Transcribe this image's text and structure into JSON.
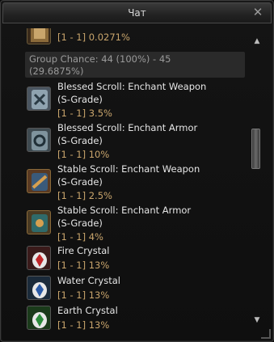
{
  "window": {
    "title": "Чат"
  },
  "top_partial_chance": "[1 - 1] 0.0271%",
  "group_chance": {
    "line1": "Group Chance: 44 (100%) - 45",
    "line2": "(29.6875%)"
  },
  "items": [
    {
      "name": "Blessed Scroll: Enchant Weapon",
      "grade": "(S-Grade)",
      "chance": "[1 - 1] 3.5%",
      "icon": "blessed-weapon-scroll-icon"
    },
    {
      "name": "Blessed Scroll: Enchant Armor",
      "grade": "(S-Grade)",
      "chance": "[1 - 1] 10%",
      "icon": "blessed-armor-scroll-icon"
    },
    {
      "name": "Stable Scroll: Enchant Weapon",
      "grade": "(S-Grade)",
      "chance": "[1 - 1] 2.5%",
      "icon": "stable-weapon-scroll-icon"
    },
    {
      "name": "Stable Scroll: Enchant Armor",
      "grade": "(S-Grade)",
      "chance": "[1 - 1] 4%",
      "icon": "stable-armor-scroll-icon"
    },
    {
      "name": "Fire Crystal",
      "chance": "[1 - 1] 13%",
      "icon": "fire-crystal-icon"
    },
    {
      "name": "Water Crystal",
      "chance": "[1 - 1] 13%",
      "icon": "water-crystal-icon"
    },
    {
      "name": "Earth Crystal",
      "chance": "[1 - 1] 13%",
      "icon": "earth-crystal-icon"
    }
  ],
  "colors": {
    "item_name": "#e6e6e6",
    "chance": "#c9a56c",
    "group": "#9a9a9a"
  }
}
